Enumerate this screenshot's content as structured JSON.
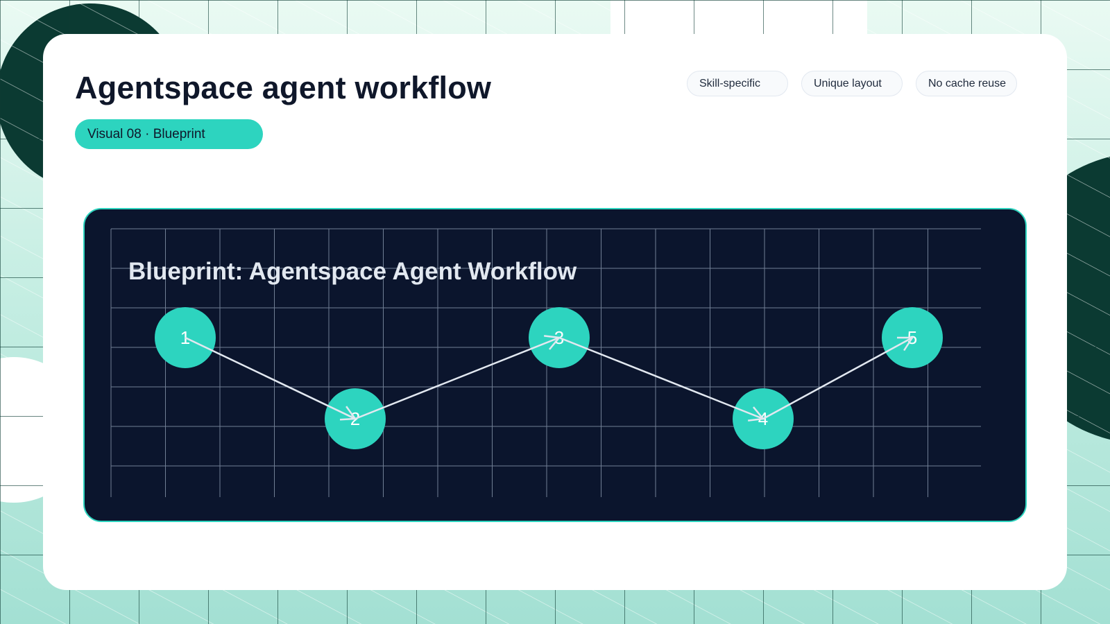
{
  "header": {
    "title": "Agentspace agent workflow",
    "subtitle": "Visual 08 · Blueprint",
    "tags": [
      "Skill-specific",
      "Unique layout",
      "No cache reuse"
    ]
  },
  "diagram": {
    "title": "Blueprint: Agentspace Agent Workflow",
    "nodes": [
      {
        "label": "1",
        "level": "high"
      },
      {
        "label": "2",
        "level": "low"
      },
      {
        "label": "3",
        "level": "high"
      },
      {
        "label": "4",
        "level": "low"
      },
      {
        "label": "5",
        "level": "high"
      }
    ],
    "edges": [
      [
        "1",
        "2"
      ],
      [
        "2",
        "3"
      ],
      [
        "3",
        "4"
      ],
      [
        "4",
        "5"
      ]
    ]
  },
  "colors": {
    "accent": "#2dd4bf",
    "panel": "#0b152d",
    "grid": "#94a3b8",
    "title_text": "#0f172a",
    "arrow": "#e2e8f0",
    "bg_dark": "#0b3a32"
  }
}
